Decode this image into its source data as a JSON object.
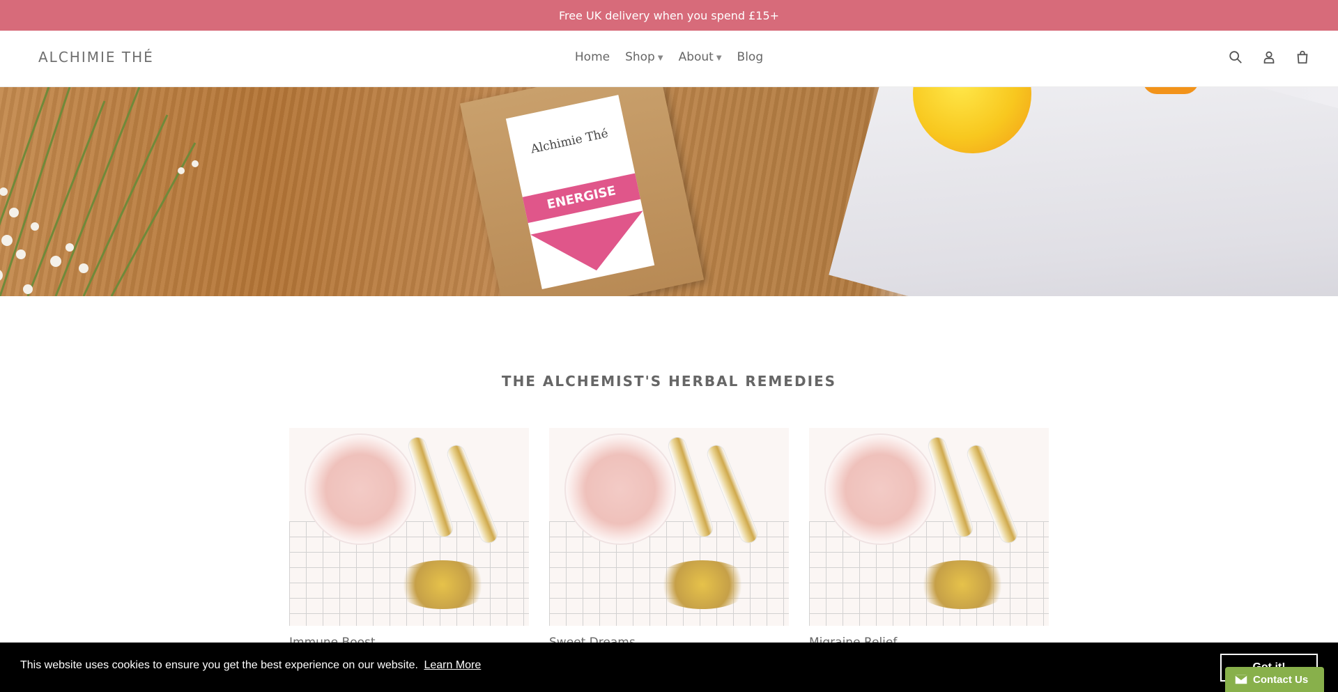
{
  "announcement": {
    "text": "Free UK delivery when you spend £15+"
  },
  "header": {
    "logo": "ALCHIMIE THÉ",
    "nav": [
      {
        "label": "Home",
        "has_dropdown": false
      },
      {
        "label": "Shop",
        "has_dropdown": true
      },
      {
        "label": "About",
        "has_dropdown": true
      },
      {
        "label": "Blog",
        "has_dropdown": false
      }
    ],
    "icons": [
      "search-icon",
      "account-icon",
      "cart-icon"
    ]
  },
  "hero": {
    "bag_brand": "Alchimie Thé",
    "bag_label": "ENERGISE"
  },
  "section": {
    "title": "THE ALCHEMIST'S HERBAL REMEDIES",
    "products": [
      {
        "name": "Immune Boost"
      },
      {
        "name": "Sweet Dreams"
      },
      {
        "name": "Migraine Relief"
      }
    ]
  },
  "cookie": {
    "message": "This website uses cookies to ensure you get the best experience on our website.",
    "learn_more": "Learn More",
    "accept": "Got it!"
  },
  "contact": {
    "label": "Contact Us"
  },
  "colors": {
    "announcement_bg": "#d76b7a",
    "contact_bg": "#88b04b",
    "cookie_bg": "#000000"
  }
}
